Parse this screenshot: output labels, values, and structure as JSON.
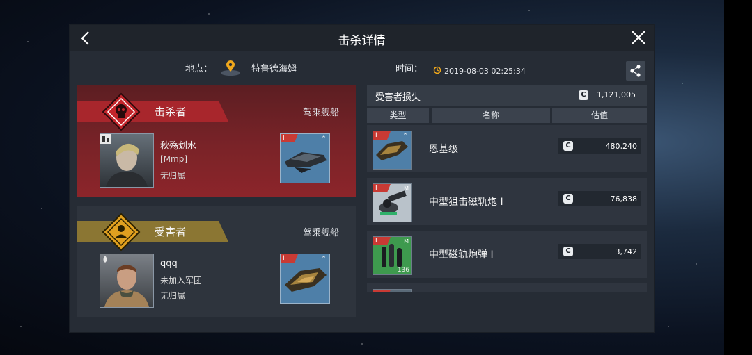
{
  "header": {
    "title": "击杀详情"
  },
  "location": {
    "label": "地点：",
    "name": "特鲁德海姆"
  },
  "time": {
    "label": "时间：",
    "value": "2019-08-03 02:25:34"
  },
  "killer": {
    "role": "击杀者",
    "ship_header": "驾乘舰船",
    "name": "秋殇划水",
    "corp": "[Mmp]",
    "alliance": "无归属",
    "ship_tag": "I"
  },
  "victim": {
    "role": "受害者",
    "ship_header": "驾乘舰船",
    "name": "qqq",
    "corp": "未加入军团",
    "alliance": "无归属",
    "ship_tag": "I"
  },
  "losses": {
    "title": "受害者损失",
    "currency": "C",
    "total": "1,121,005",
    "columns": [
      "类型",
      "名称",
      "估值"
    ],
    "items": [
      {
        "name": "恩基级",
        "value": "480,240",
        "tag": "I",
        "slot": "",
        "qty": ""
      },
      {
        "name": "中型狙击磁轨炮 Ⅰ",
        "value": "76,838",
        "tag": "I",
        "slot": "M",
        "qty": ""
      },
      {
        "name": "中型磁轨炮弹 Ⅰ",
        "value": "3,742",
        "tag": "I",
        "slot": "M",
        "qty": "136"
      }
    ]
  },
  "colors": {
    "killer_red": "#b42a2f",
    "victim_gold": "#e0a020",
    "panel": "#262c35"
  }
}
